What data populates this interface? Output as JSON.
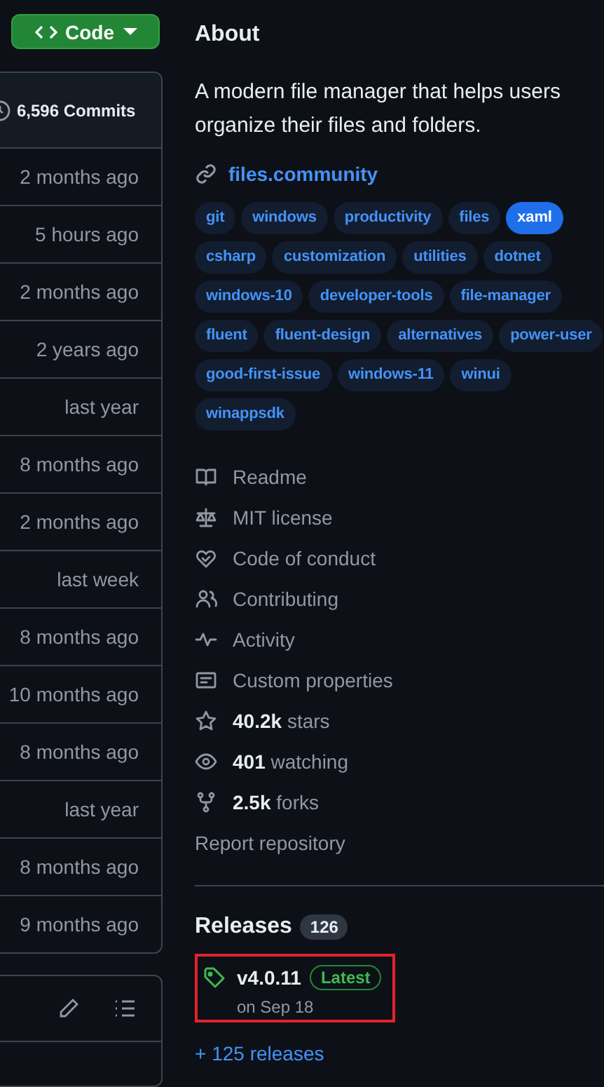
{
  "code_button": {
    "label": "Code"
  },
  "commits": {
    "count": "6,596 Commits",
    "times": [
      "2 months ago",
      "5 hours ago",
      "2 months ago",
      "2 years ago",
      "last year",
      "8 months ago",
      "2 months ago",
      "last week",
      "8 months ago",
      "10 months ago",
      "8 months ago",
      "last year",
      "8 months ago",
      "9 months ago"
    ]
  },
  "about": {
    "title": "About",
    "description": "A modern file manager that helps users organize their files and folders.",
    "link": "files.community",
    "topics": [
      {
        "label": "git",
        "selected": false
      },
      {
        "label": "windows",
        "selected": false
      },
      {
        "label": "productivity",
        "selected": false
      },
      {
        "label": "files",
        "selected": false
      },
      {
        "label": "xaml",
        "selected": true
      },
      {
        "label": "csharp",
        "selected": false
      },
      {
        "label": "customization",
        "selected": false
      },
      {
        "label": "utilities",
        "selected": false
      },
      {
        "label": "dotnet",
        "selected": false
      },
      {
        "label": "windows-10",
        "selected": false
      },
      {
        "label": "developer-tools",
        "selected": false
      },
      {
        "label": "file-manager",
        "selected": false
      },
      {
        "label": "fluent",
        "selected": false
      },
      {
        "label": "fluent-design",
        "selected": false
      },
      {
        "label": "alternatives",
        "selected": false
      },
      {
        "label": "power-user",
        "selected": false
      },
      {
        "label": "good-first-issue",
        "selected": false
      },
      {
        "label": "windows-11",
        "selected": false
      },
      {
        "label": "winui",
        "selected": false
      },
      {
        "label": "winappsdk",
        "selected": false
      }
    ],
    "items": [
      {
        "kind": "book",
        "label": "Readme"
      },
      {
        "kind": "scale",
        "label": "MIT license"
      },
      {
        "kind": "heart",
        "label": "Code of conduct"
      },
      {
        "kind": "people",
        "label": "Contributing"
      },
      {
        "kind": "pulse",
        "label": "Activity"
      },
      {
        "kind": "note",
        "label": "Custom properties"
      },
      {
        "kind": "star",
        "count": "40.2k",
        "label": "stars"
      },
      {
        "kind": "eye",
        "count": "401",
        "label": "watching"
      },
      {
        "kind": "fork",
        "count": "2.5k",
        "label": "forks"
      },
      {
        "kind": "plain",
        "label": "Report repository"
      }
    ]
  },
  "releases": {
    "title": "Releases",
    "count": "126",
    "latest": {
      "tag": "v4.0.11",
      "badge": "Latest",
      "date": "on Sep 18",
      "highlighted": true
    },
    "more": "+ 125 releases"
  }
}
